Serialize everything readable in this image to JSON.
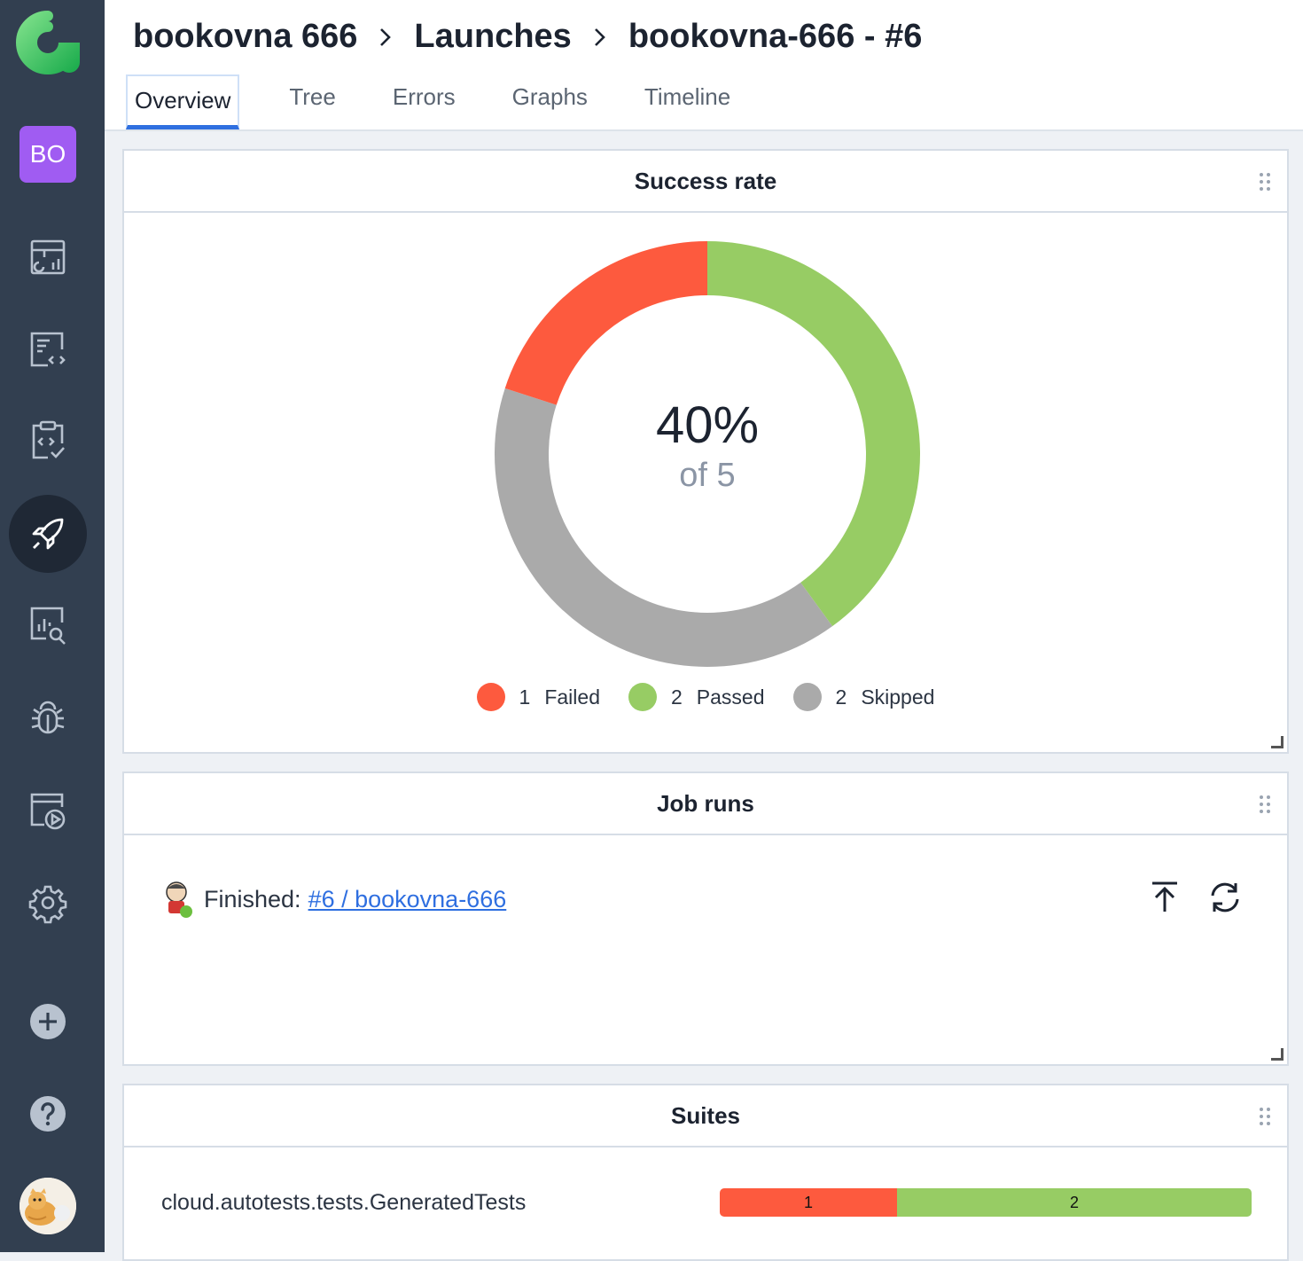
{
  "breadcrumb": {
    "project": "bookovna 666",
    "section": "Launches",
    "launch": "bookovna-666 - #6"
  },
  "tabs": [
    {
      "label": "Overview",
      "active": true
    },
    {
      "label": "Tree"
    },
    {
      "label": "Errors"
    },
    {
      "label": "Graphs"
    },
    {
      "label": "Timeline"
    }
  ],
  "sidebar": {
    "project_initials": "BO",
    "items": [
      "dashboards-icon",
      "test-cases-icon",
      "test-plans-icon",
      "launches-icon",
      "analytics-icon",
      "defects-icon",
      "jobs-icon",
      "settings-icon"
    ],
    "active_item": "launches-icon",
    "bottom": [
      "add-icon",
      "help-icon",
      "user-avatar"
    ]
  },
  "success_rate": {
    "title": "Success rate",
    "percent_label": "40%",
    "of_label": "of 5",
    "chart_data": {
      "type": "pie",
      "total": 5,
      "series": [
        {
          "name": "Passed",
          "value": 2,
          "color": "#97cc64"
        },
        {
          "name": "Skipped",
          "value": 2,
          "color": "#aaaaaa"
        },
        {
          "name": "Failed",
          "value": 1,
          "color": "#fd5a3e"
        }
      ]
    },
    "legend": [
      {
        "count": "1",
        "label": "Failed",
        "color": "#fd5a3e"
      },
      {
        "count": "2",
        "label": "Passed",
        "color": "#97cc64"
      },
      {
        "count": "2",
        "label": "Skipped",
        "color": "#aaaaaa"
      }
    ]
  },
  "job_runs": {
    "title": "Job runs",
    "status_text": "Finished:",
    "link_text": "#6 / bookovna-666"
  },
  "suites": {
    "title": "Suites",
    "rows": [
      {
        "name": "cloud.autotests.tests.GeneratedTests",
        "failed": 1,
        "passed": 2,
        "failed_label": "1",
        "passed_label": "2"
      }
    ]
  },
  "colors": {
    "failed": "#fd5a3e",
    "passed": "#97cc64",
    "skipped": "#aaaaaa",
    "accent": "#2f6fe0",
    "sidebar": "#323f50"
  }
}
